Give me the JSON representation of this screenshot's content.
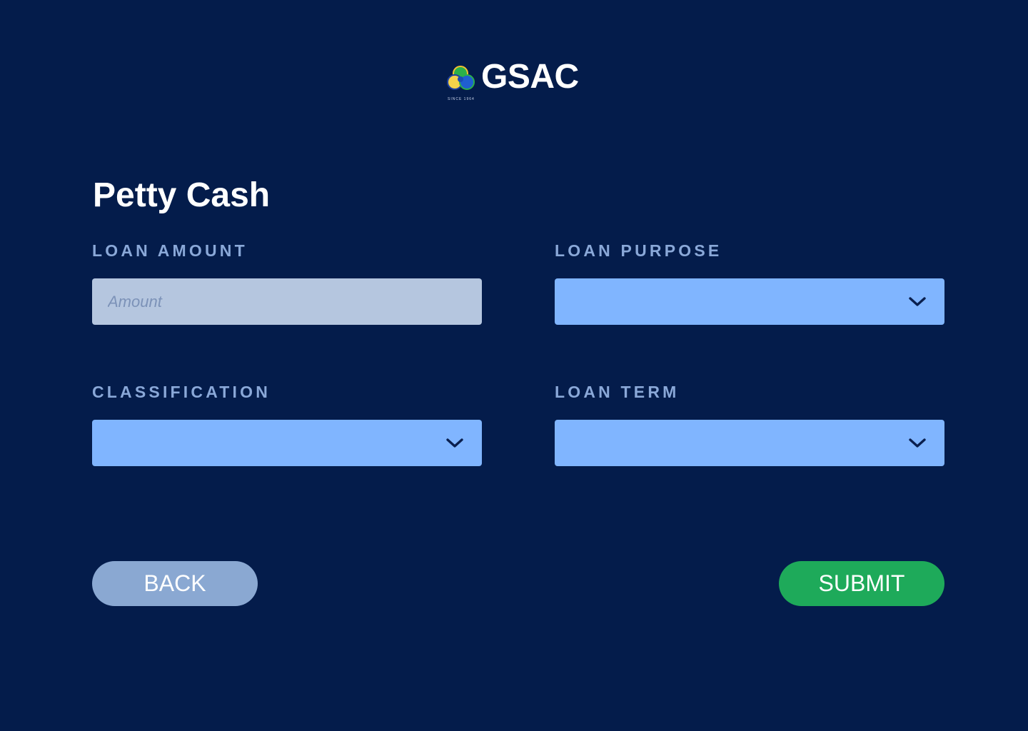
{
  "brand": {
    "name": "GSAC",
    "tagline": "SINCE 1964"
  },
  "page": {
    "title": "Petty Cash"
  },
  "form": {
    "loan_amount": {
      "label": "LOAN AMOUNT",
      "value": "",
      "placeholder": "Amount"
    },
    "loan_purpose": {
      "label": "LOAN PURPOSE",
      "selected": ""
    },
    "classification": {
      "label": "CLASSIFICATION",
      "selected": ""
    },
    "loan_term": {
      "label": "LOAN TERM",
      "selected": ""
    }
  },
  "actions": {
    "back_label": "BACK",
    "submit_label": "SUBMIT"
  },
  "icons": {
    "logo": "gsac-logo-icon",
    "dropdown": "chevron-down-icon"
  },
  "colors": {
    "background": "#041c4b",
    "input_disabled": "#b5c6df",
    "select": "#80b5ff",
    "label": "#8aa8d8",
    "back_button": "#8aa8d2",
    "submit_button": "#1eaa5a"
  }
}
